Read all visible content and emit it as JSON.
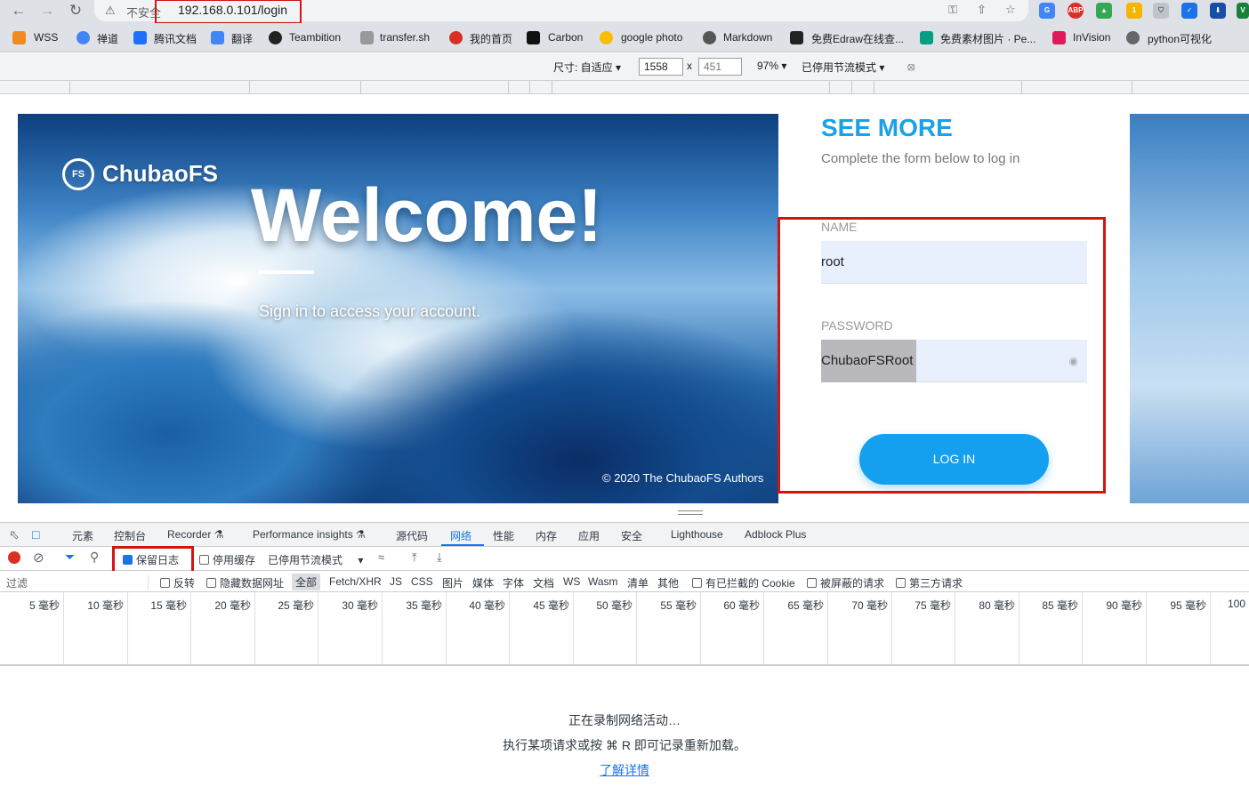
{
  "browser": {
    "insecure_label": "不安全",
    "url": "192.168.0.101/login",
    "extensions": [
      "G",
      "ABP",
      "▲",
      "1",
      "⛉",
      "✓",
      "⬇",
      "V"
    ]
  },
  "bookmarks": [
    "WSS",
    "禅道",
    "腾讯文档",
    "翻译",
    "Teambition",
    "transfer.sh",
    "我的首页",
    "Carbon",
    "google photo",
    "Markdown",
    "免费Edraw在线查...",
    "免费素材图片 · Pe...",
    "InVision",
    "python可视化"
  ],
  "device_toolbar": {
    "size_label": "尺寸: 自适应 ▾",
    "width": "1558",
    "times": "x",
    "height": "451",
    "zoom": "97% ▾",
    "throttle": "已停用节流模式 ▾"
  },
  "hero": {
    "logo_mark": "FS",
    "logo": "ChubaoFS",
    "welcome": "Welcome!",
    "subtitle": "Sign in to access your account.",
    "copyright": "© 2020 The ChubaoFS Authors"
  },
  "form": {
    "heading": "SEE MORE",
    "subheading": "Complete the form below to log in",
    "name_label": "NAME",
    "name_value": "root",
    "password_label": "PASSWORD",
    "password_value": "ChubaoFSRoot",
    "login_button": "LOG IN"
  },
  "devtools": {
    "tabs": [
      "元素",
      "控制台",
      "Recorder ⚗",
      "Performance insights ⚗",
      "源代码",
      "网络",
      "性能",
      "内存",
      "应用",
      "安全",
      "Lighthouse",
      "Adblock Plus"
    ],
    "active_tab": "网络",
    "preserve_log": "保留日志",
    "disable_cache": "停用缓存",
    "throttle": "已停用节流模式",
    "filter_placeholder": "过滤",
    "invert": "反转",
    "hide_data_urls": "隐藏数据网址",
    "type_filters": [
      "全部",
      "Fetch/XHR",
      "JS",
      "CSS",
      "图片",
      "媒体",
      "字体",
      "文档",
      "WS",
      "Wasm",
      "清单",
      "其他"
    ],
    "blocked_cookies": "有已拦截的 Cookie",
    "blocked_requests": "被屏蔽的请求",
    "third_party": "第三方请求",
    "timeline_ticks": [
      "5 毫秒",
      "10 毫秒",
      "15 毫秒",
      "20 毫秒",
      "25 毫秒",
      "30 毫秒",
      "35 毫秒",
      "40 毫秒",
      "45 毫秒",
      "50 毫秒",
      "55 毫秒",
      "60 毫秒",
      "65 毫秒",
      "70 毫秒",
      "75 毫秒",
      "80 毫秒",
      "85 毫秒",
      "90 毫秒",
      "95 毫秒",
      "100"
    ],
    "recording": "正在录制网络活动…",
    "hint": "执行某项请求或按 ⌘ R 即可记录重新加载。",
    "learn_more": "了解详情"
  }
}
